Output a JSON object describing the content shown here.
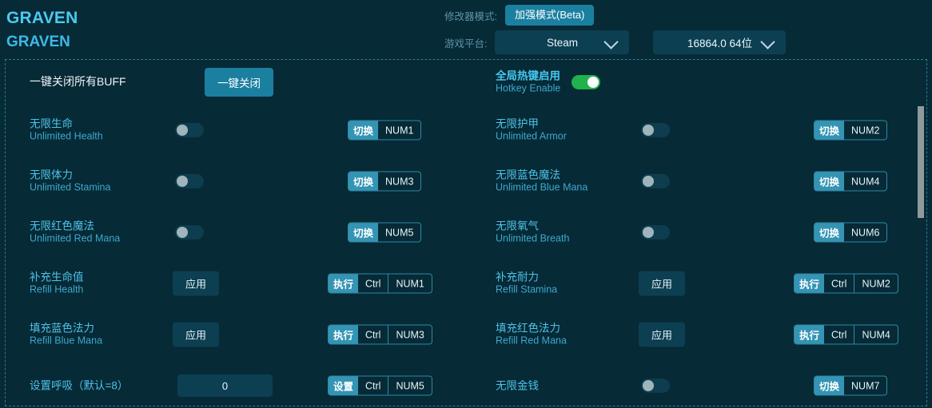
{
  "header": {
    "brand_line1": "GRAVEN",
    "brand_line2": "GRAVEN",
    "mode_label": "修改器模式:",
    "mode_value": "加强模式(Beta)",
    "platform_label": "游戏平台:",
    "platform_value": "Steam",
    "version_value": "16864.0 64位",
    "accent": "#1b7fa0",
    "background": "#062a36"
  },
  "panel": {
    "rows": [
      {
        "left": {
          "cn": "一键关闭所有BUFF",
          "en": "",
          "style": "white",
          "control": "button",
          "button_label": "一键关闭"
        },
        "right": {
          "cn": "全局热键启用",
          "en": "Hotkey Enable",
          "style": "strong",
          "control": "toggle",
          "toggle_on": true
        }
      },
      {
        "left": {
          "cn": "无限生命",
          "en": "Unlimited Health",
          "control": "toggle",
          "toggle_on": false,
          "hotkey": {
            "action": "切换",
            "keys": [
              "NUM1"
            ]
          }
        },
        "right": {
          "cn": "无限护甲",
          "en": "Unlimited Armor",
          "control": "toggle",
          "toggle_on": false,
          "hotkey": {
            "action": "切换",
            "keys": [
              "NUM2"
            ]
          }
        }
      },
      {
        "left": {
          "cn": "无限体力",
          "en": "Unlimited Stamina",
          "control": "toggle",
          "toggle_on": false,
          "hotkey": {
            "action": "切换",
            "keys": [
              "NUM3"
            ]
          }
        },
        "right": {
          "cn": "无限蓝色魔法",
          "en": "Unlimited Blue Mana",
          "control": "toggle",
          "toggle_on": false,
          "hotkey": {
            "action": "切换",
            "keys": [
              "NUM4"
            ]
          }
        }
      },
      {
        "left": {
          "cn": "无限红色魔法",
          "en": "Unlimited Red Mana",
          "control": "toggle",
          "toggle_on": false,
          "hotkey": {
            "action": "切换",
            "keys": [
              "NUM5"
            ]
          }
        },
        "right": {
          "cn": "无限氧气",
          "en": "Unlimited Breath",
          "control": "toggle",
          "toggle_on": false,
          "hotkey": {
            "action": "切换",
            "keys": [
              "NUM6"
            ]
          }
        }
      },
      {
        "left": {
          "cn": "补充生命值",
          "en": "Refill Health",
          "control": "apply",
          "button_label": "应用",
          "hotkey": {
            "action": "执行",
            "keys": [
              "Ctrl",
              "NUM1"
            ]
          }
        },
        "right": {
          "cn": "补充耐力",
          "en": "Refill Stamina",
          "control": "apply",
          "button_label": "应用",
          "hotkey": {
            "action": "执行",
            "keys": [
              "Ctrl",
              "NUM2"
            ]
          }
        }
      },
      {
        "left": {
          "cn": "填充蓝色法力",
          "en": "Refill Blue Mana",
          "control": "apply",
          "button_label": "应用",
          "hotkey": {
            "action": "执行",
            "keys": [
              "Ctrl",
              "NUM3"
            ]
          }
        },
        "right": {
          "cn": "填充红色法力",
          "en": "Refill Red Mana",
          "control": "apply",
          "button_label": "应用",
          "hotkey": {
            "action": "执行",
            "keys": [
              "Ctrl",
              "NUM4"
            ]
          }
        }
      },
      {
        "left": {
          "cn": "设置呼吸（默认=8）",
          "en": "",
          "control": "input",
          "input_value": "0",
          "hotkey": {
            "action": "设置",
            "keys": [
              "Ctrl",
              "NUM5"
            ]
          }
        },
        "right": {
          "cn": "无限金钱",
          "en": "",
          "control": "toggle",
          "toggle_on": false,
          "hotkey": {
            "action": "切换",
            "keys": [
              "NUM7"
            ]
          }
        }
      }
    ]
  }
}
